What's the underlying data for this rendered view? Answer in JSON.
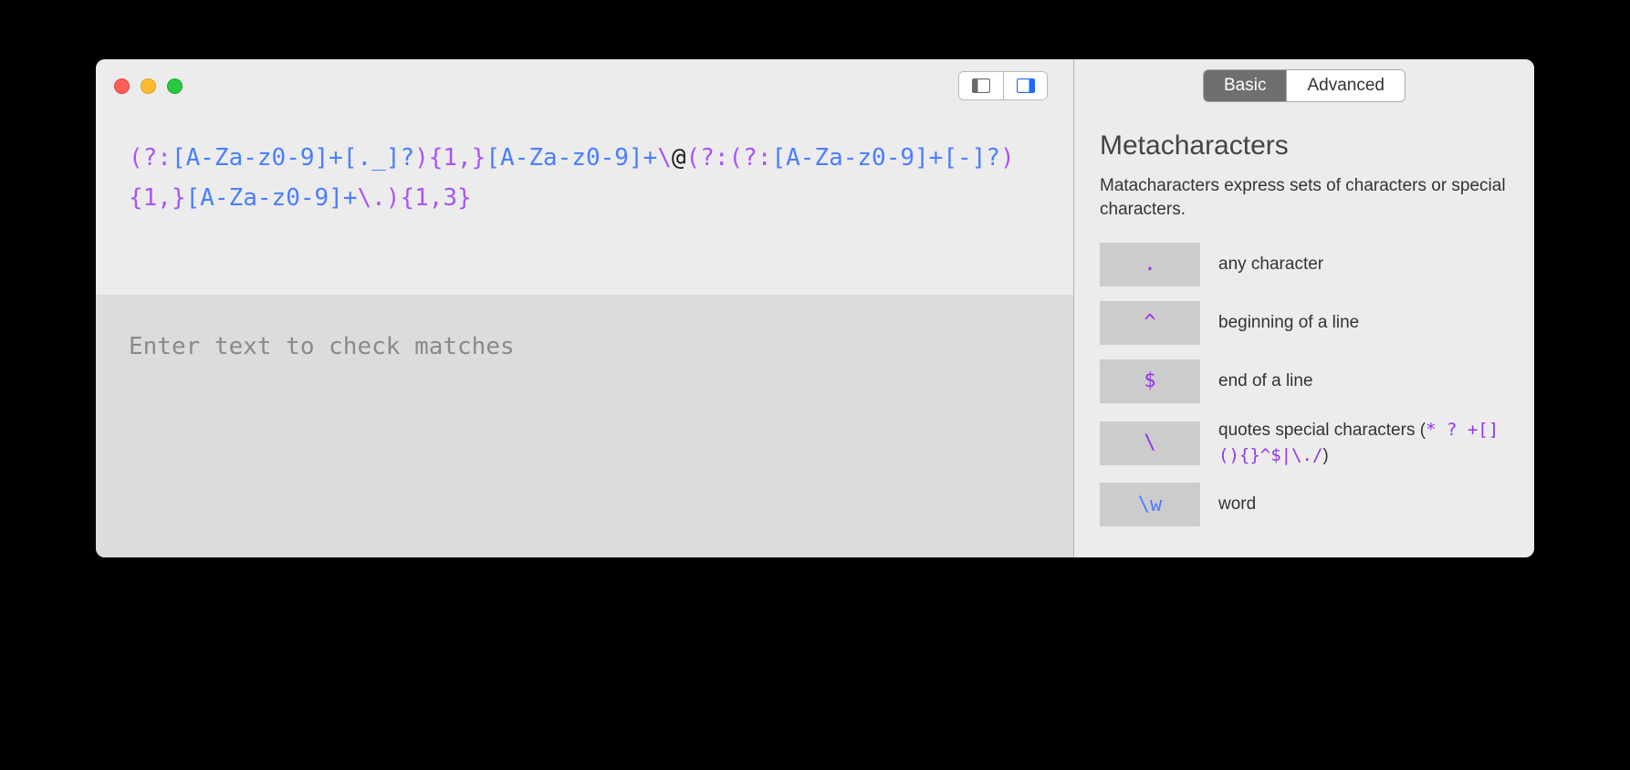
{
  "regex": {
    "tokens": [
      {
        "t": "(",
        "c": "purple"
      },
      {
        "t": "?:",
        "c": "purple"
      },
      {
        "t": "[A-Za-z0-9]",
        "c": "blue"
      },
      {
        "t": "+",
        "c": "blue"
      },
      {
        "t": "[._]",
        "c": "blue"
      },
      {
        "t": "?",
        "c": "blue"
      },
      {
        "t": ")",
        "c": "purple"
      },
      {
        "t": "{1,}",
        "c": "purple"
      },
      {
        "t": "[A-Za-z0-9]",
        "c": "blue"
      },
      {
        "t": "+",
        "c": "blue"
      },
      {
        "t": "\\",
        "c": "purple"
      },
      {
        "t": "@",
        "c": "black"
      },
      {
        "t": "(",
        "c": "purple"
      },
      {
        "t": "?:",
        "c": "purple"
      },
      {
        "t": "(",
        "c": "purple"
      },
      {
        "t": "?:",
        "c": "purple"
      },
      {
        "t": "[A-Za-z0-9]",
        "c": "blue"
      },
      {
        "t": "+",
        "c": "blue"
      },
      {
        "t": "[-]",
        "c": "blue"
      },
      {
        "t": "?",
        "c": "blue"
      },
      {
        "t": ")",
        "c": "purple"
      },
      {
        "t": "{1,}",
        "c": "purple"
      },
      {
        "t": "[A-Za-z0-9]",
        "c": "blue"
      },
      {
        "t": "+",
        "c": "blue"
      },
      {
        "t": "\\.",
        "c": "purple"
      },
      {
        "t": ")",
        "c": "purple"
      },
      {
        "t": "{1,3}",
        "c": "purple"
      }
    ]
  },
  "match_placeholder": "Enter text to check matches",
  "tabs": {
    "basic": "Basic",
    "advanced": "Advanced"
  },
  "reference": {
    "title": "Metacharacters",
    "description": "Matacharacters express sets of characters or special characters.",
    "items": [
      {
        "symbol": ".",
        "sym_color": "purple",
        "label_prefix": "any character",
        "label_specials": "",
        "label_suffix": ""
      },
      {
        "symbol": "^",
        "sym_color": "purple",
        "label_prefix": "beginning of a line",
        "label_specials": "",
        "label_suffix": ""
      },
      {
        "symbol": "$",
        "sym_color": "purple",
        "label_prefix": "end of a line",
        "label_specials": "",
        "label_suffix": ""
      },
      {
        "symbol": "\\",
        "sym_color": "purple",
        "label_prefix": "quotes special characters (",
        "label_specials": "* ? +[](){}^$|\\./",
        "label_suffix": ")"
      },
      {
        "symbol": "\\w",
        "sym_color": "blue",
        "label_prefix": "word",
        "label_specials": "",
        "label_suffix": ""
      }
    ]
  }
}
